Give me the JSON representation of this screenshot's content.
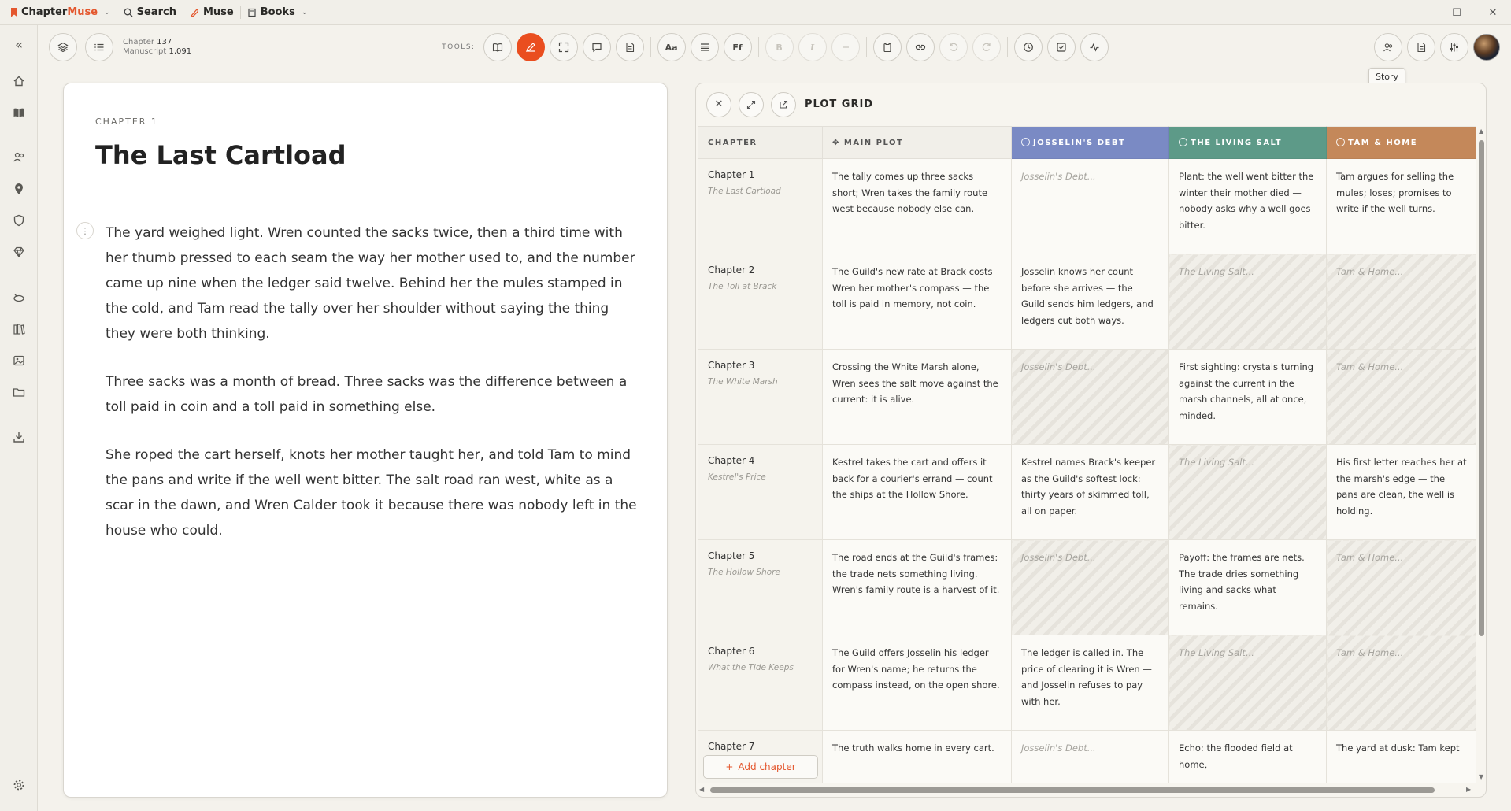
{
  "app": {
    "brand_primary": "Chapter",
    "brand_accent": "Muse",
    "nav": [
      {
        "label": "Search",
        "icon": "search-icon"
      },
      {
        "label": "Muse",
        "icon": "quill-icon"
      },
      {
        "label": "Books",
        "icon": "book-icon"
      }
    ],
    "window_controls": [
      "—",
      "☐",
      "✕"
    ]
  },
  "toolbar": {
    "chapter_label": "Chapter",
    "chapter_count": "137",
    "manuscript_label": "Manuscript",
    "manuscript_count": "1,091",
    "tools_label": "TOOLS:",
    "format_aa": "Aa",
    "format_ff": "Ff",
    "format_b": "B",
    "format_i": "I",
    "tooltip": "Story"
  },
  "editor": {
    "chapter_label": "CHAPTER 1",
    "title": "The Last Cartload",
    "paragraphs": [
      "The yard weighed light. Wren counted the sacks twice, then a third time with her thumb pressed to each seam the way her mother used to, and the number came up nine when the ledger said twelve. Behind her the mules stamped in the cold, and Tam read the tally over her shoulder without saying the thing they were both thinking.",
      "Three sacks was a month of bread. Three sacks was the difference between a toll paid in coin and a toll paid in something else.",
      "She roped the cart herself, knots her mother taught her, and told Tam to mind the pans and write if the well went bitter. The salt road ran west, white as a scar in the dawn, and Wren Calder took it because there was nobody left in the house who could."
    ]
  },
  "plot_grid": {
    "title": "PLOT GRID",
    "add_chapter": "Add chapter",
    "columns": [
      {
        "label": "CHAPTER"
      },
      {
        "label": "MAIN PLOT"
      },
      {
        "label": "JOSSELIN'S DEBT",
        "color": "#7a8ac4"
      },
      {
        "label": "THE LIVING SALT",
        "color": "#5d9a88"
      },
      {
        "label": "TAM & HOME",
        "color": "#c4885a"
      }
    ],
    "rows": [
      {
        "num": "Chapter 1",
        "sub": "The Last Cartload",
        "cells": [
          {
            "text": "The tally comes up three sacks short; Wren takes the family route west because nobody else can.",
            "state": "filled"
          },
          {
            "text": "Josselin's Debt...",
            "state": "placeholder"
          },
          {
            "text": "Plant: the well went bitter the winter their mother died — nobody asks why a well goes bitter.",
            "state": "filled"
          },
          {
            "text": "Tam argues for selling the mules; loses; promises to write if the well turns.",
            "state": "filled"
          }
        ]
      },
      {
        "num": "Chapter 2",
        "sub": "The Toll at Brack",
        "cells": [
          {
            "text": "The Guild's new rate at Brack costs Wren her mother's compass — the toll is paid in memory, not coin.",
            "state": "filled"
          },
          {
            "text": "Josselin knows her count before she arrives — the Guild sends him ledgers, and ledgers cut both ways.",
            "state": "filled"
          },
          {
            "text": "The Living Salt...",
            "state": "empty"
          },
          {
            "text": "Tam & Home...",
            "state": "empty"
          }
        ]
      },
      {
        "num": "Chapter 3",
        "sub": "The White Marsh",
        "cells": [
          {
            "text": "Crossing the White Marsh alone, Wren sees the salt move against the current: it is alive.",
            "state": "filled"
          },
          {
            "text": "Josselin's Debt...",
            "state": "empty"
          },
          {
            "text": "First sighting: crystals turning against the current in the marsh channels, all at once, minded.",
            "state": "filled"
          },
          {
            "text": "Tam & Home...",
            "state": "empty"
          }
        ]
      },
      {
        "num": "Chapter 4",
        "sub": "Kestrel's Price",
        "cells": [
          {
            "text": "Kestrel takes the cart and offers it back for a courier's errand — count the ships at the Hollow Shore.",
            "state": "filled"
          },
          {
            "text": "Kestrel names Brack's keeper as the Guild's softest lock: thirty years of skimmed toll, all on paper.",
            "state": "filled"
          },
          {
            "text": "The Living Salt...",
            "state": "empty"
          },
          {
            "text": "His first letter reaches her at the marsh's edge — the pans are clean, the well is holding.",
            "state": "filled"
          }
        ]
      },
      {
        "num": "Chapter 5",
        "sub": "The Hollow Shore",
        "cells": [
          {
            "text": "The road ends at the Guild's frames: the trade nets something living. Wren's family route is a harvest of it.",
            "state": "filled"
          },
          {
            "text": "Josselin's Debt...",
            "state": "empty"
          },
          {
            "text": "Payoff: the frames are nets. The trade dries something living and sacks what remains.",
            "state": "filled"
          },
          {
            "text": "Tam & Home...",
            "state": "empty"
          }
        ]
      },
      {
        "num": "Chapter 6",
        "sub": "What the Tide Keeps",
        "cells": [
          {
            "text": "The Guild offers Josselin his ledger for Wren's name; he returns the compass instead, on the open shore.",
            "state": "filled"
          },
          {
            "text": "The ledger is called in. The price of clearing it is Wren — and Josselin refuses to pay with her.",
            "state": "filled"
          },
          {
            "text": "The Living Salt...",
            "state": "empty"
          },
          {
            "text": "Tam & Home...",
            "state": "empty"
          }
        ]
      },
      {
        "num": "Chapter 7",
        "sub": "",
        "cells": [
          {
            "text": "The truth walks home in every cart.",
            "state": "filled"
          },
          {
            "text": "Josselin's Debt...",
            "state": "placeholder"
          },
          {
            "text": "Echo: the flooded field at home,",
            "state": "filled"
          },
          {
            "text": "The yard at dusk: Tam kept",
            "state": "filled"
          }
        ]
      }
    ]
  },
  "colors": {
    "accent": "#e4572e",
    "active_tool": "#ea4e1f"
  }
}
